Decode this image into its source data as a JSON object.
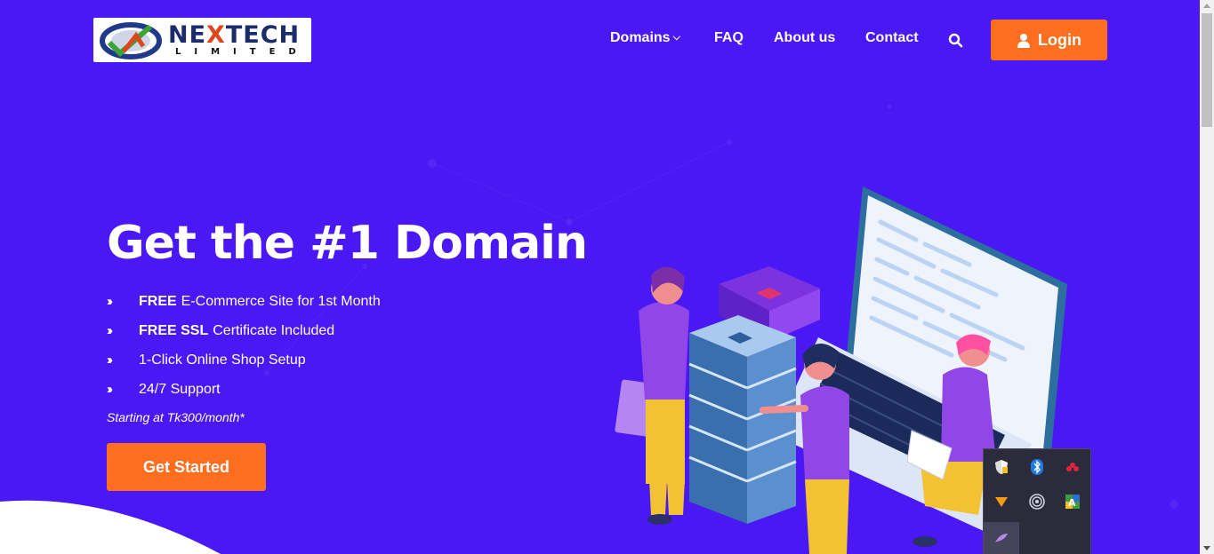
{
  "brand": {
    "name_a": "NE",
    "name_x": "X",
    "name_b": "TECH",
    "sub": "LIMITED"
  },
  "nav": {
    "items": [
      {
        "label": "Domains",
        "has_dropdown": true
      },
      {
        "label": "FAQ"
      },
      {
        "label": "About us"
      },
      {
        "label": "Contact"
      }
    ],
    "search_icon": "search-icon",
    "login_label": "Login",
    "login_icon": "user-icon"
  },
  "hero": {
    "title": "Get the #1 Domain",
    "features": [
      {
        "bold": "FREE",
        "text": "E-Commerce Site for 1st Month"
      },
      {
        "bold": "FREE SSL",
        "text": "Certificate Included"
      },
      {
        "bold": "",
        "text": "1-Click Online Shop Setup"
      },
      {
        "bold": "",
        "text": "24/7 Support"
      }
    ],
    "starting": "Starting at Tk300/month*",
    "cta_label": "Get Started"
  },
  "tray": {
    "icons": [
      "security-shield-icon",
      "bluetooth-icon",
      "app-red-icon",
      "vlc-cone-icon",
      "network-icon",
      "keyboard-language-icon",
      "feather-icon"
    ]
  },
  "colors": {
    "background": "#4a17f5",
    "accent": "#fd6f1f",
    "text": "#ffffff"
  }
}
